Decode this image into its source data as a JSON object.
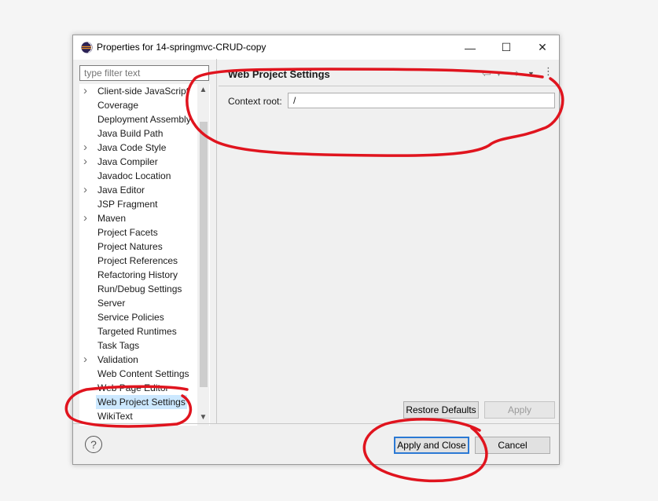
{
  "window": {
    "title": "Properties for 14-springmvc-CRUD-copy",
    "minimize_glyph": "—",
    "maximize_glyph": "☐",
    "close_glyph": "✕"
  },
  "sidebar": {
    "filter_placeholder": "type filter text",
    "items": [
      {
        "label": "Client-side JavaScript",
        "expandable": true
      },
      {
        "label": "Coverage",
        "expandable": false
      },
      {
        "label": "Deployment Assembly",
        "expandable": false
      },
      {
        "label": "Java Build Path",
        "expandable": false
      },
      {
        "label": "Java Code Style",
        "expandable": true
      },
      {
        "label": "Java Compiler",
        "expandable": true
      },
      {
        "label": "Javadoc Location",
        "expandable": false
      },
      {
        "label": "Java Editor",
        "expandable": true
      },
      {
        "label": "JSP Fragment",
        "expandable": false
      },
      {
        "label": "Maven",
        "expandable": true
      },
      {
        "label": "Project Facets",
        "expandable": false
      },
      {
        "label": "Project Natures",
        "expandable": false
      },
      {
        "label": "Project References",
        "expandable": false
      },
      {
        "label": "Refactoring History",
        "expandable": false
      },
      {
        "label": "Run/Debug Settings",
        "expandable": false
      },
      {
        "label": "Server",
        "expandable": false
      },
      {
        "label": "Service Policies",
        "expandable": false
      },
      {
        "label": "Targeted Runtimes",
        "expandable": false
      },
      {
        "label": "Task Tags",
        "expandable": false
      },
      {
        "label": "Validation",
        "expandable": true
      },
      {
        "label": "Web Content Settings",
        "expandable": false
      },
      {
        "label": "Web Page Editor",
        "expandable": false
      },
      {
        "label": "Web Project Settings",
        "expandable": false,
        "selected": true
      },
      {
        "label": "WikiText",
        "expandable": false
      }
    ]
  },
  "main": {
    "page_title": "Web Project Settings",
    "context_root_label": "Context root:",
    "context_root_value": "/",
    "restore_defaults_label": "Restore Defaults",
    "apply_label": "Apply"
  },
  "footer": {
    "help_glyph": "?",
    "apply_close_label": "Apply and Close",
    "cancel_label": "Cancel"
  },
  "colors": {
    "selection": "#cce8ff",
    "primary_border": "#2b79d4",
    "annotation_red": "#e0141e"
  }
}
